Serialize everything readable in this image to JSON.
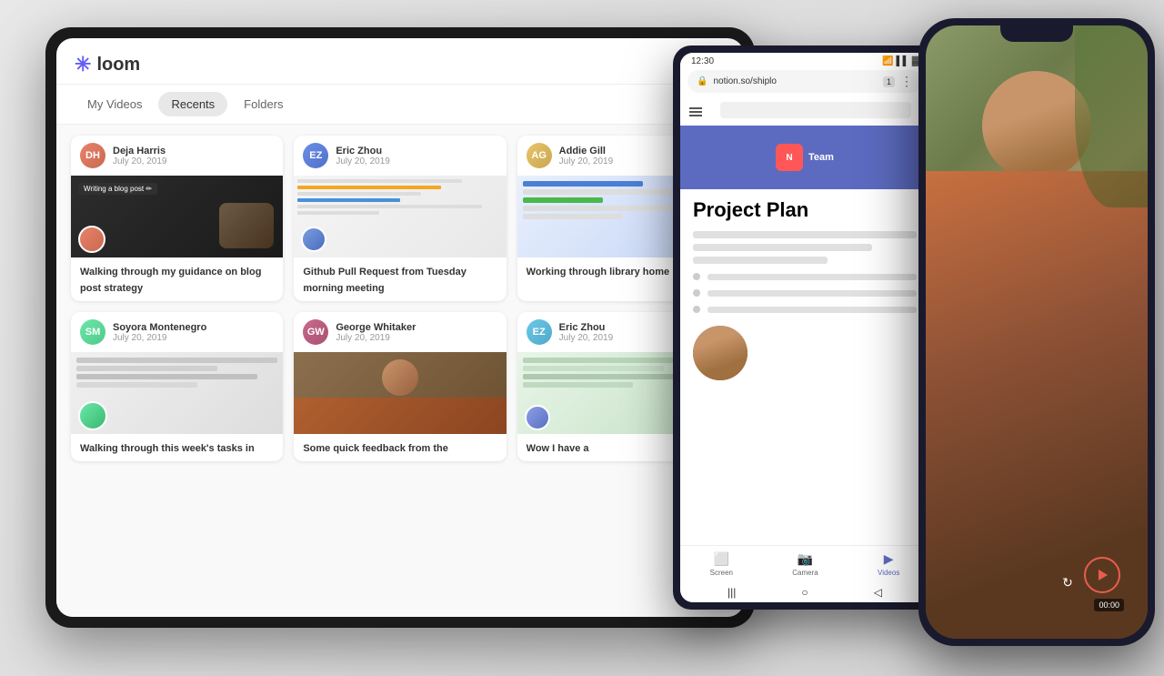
{
  "app": {
    "name": "loom",
    "logo_symbol": "✳",
    "settings_symbol": "⚙"
  },
  "tabs": {
    "my_videos": "My Videos",
    "recents": "Recents",
    "folders": "Folders"
  },
  "cards": [
    {
      "author": "Deja Harris",
      "date": "July 20, 2019",
      "title": "Walking through my guidance on blog post strategy",
      "avatar_initials": "DH",
      "avatar_class": "avatar-deja",
      "thumbnail_type": "blog"
    },
    {
      "author": "Eric Zhou",
      "date": "July 20, 2019",
      "title": "Github Pull Request from Tuesday morning meeting",
      "avatar_initials": "EZ",
      "avatar_class": "avatar-eric",
      "thumbnail_type": "github"
    },
    {
      "author": "Addie Gill",
      "date": "July 20, 2019",
      "title": "Working through library home",
      "avatar_initials": "AG",
      "avatar_class": "avatar-addie",
      "thumbnail_type": "working"
    },
    {
      "author": "Soyora Montenegro",
      "date": "July 20, 2019",
      "title": "Walking through this week's tasks in",
      "avatar_initials": "SM",
      "avatar_class": "avatar-soyora",
      "thumbnail_type": "screen"
    },
    {
      "author": "George Whitaker",
      "date": "July 20, 2019",
      "title": "Some quick feedback from the",
      "avatar_initials": "GW",
      "avatar_class": "avatar-george",
      "thumbnail_type": "person"
    },
    {
      "author": "Eric Zhou",
      "date": "July 20, 2019",
      "title": "Wow I have a",
      "avatar_initials": "EZ",
      "avatar_class": "avatar-ericzhou2",
      "thumbnail_type": "calendar"
    }
  ],
  "android": {
    "time": "12:30",
    "url": "notion.so/shiplo",
    "project_title": "Project Plan",
    "nav_items": [
      "Screen",
      "Camera",
      "Videos"
    ]
  },
  "iphone": {
    "timer": "00:00"
  }
}
